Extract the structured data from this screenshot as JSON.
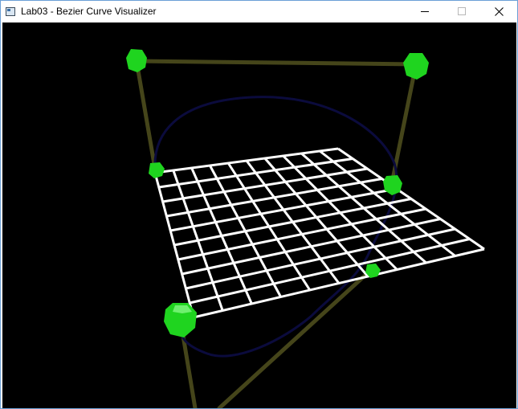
{
  "window": {
    "title": "Lab03 - Bezier Curve Visualizer",
    "controls": [
      "minimize",
      "maximize",
      "close"
    ]
  },
  "scene": {
    "background_color": "#000000",
    "control_polygon_color": "#45451a",
    "bezier_curve_color": "#0b0b3d",
    "surface_grid_color": "#ffffff",
    "control_point_color": "#1fd41f",
    "grid": {
      "rows": 10,
      "cols": 10
    },
    "control_points": [
      "control-point-top-left",
      "control-point-top-right",
      "control-point-mid-left",
      "control-point-mid-right",
      "control-point-lower-right",
      "control-point-bottom-left"
    ]
  }
}
